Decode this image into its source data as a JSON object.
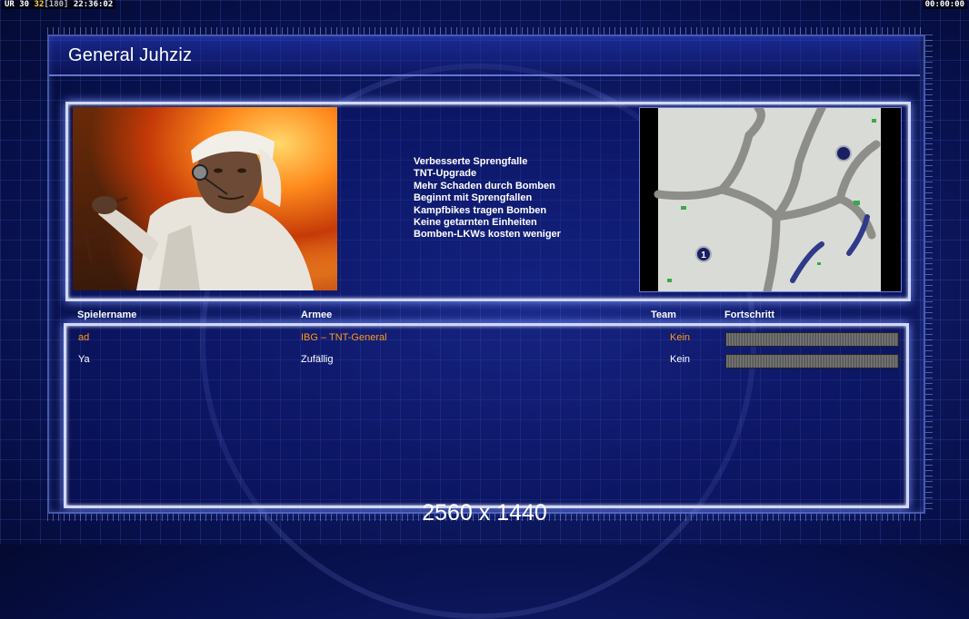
{
  "hud": {
    "left_prefix": "UR",
    "fps_a": "30",
    "fps_b": "32",
    "fps_c": "[180]",
    "clock": "22:36:02",
    "game_timer": "00:00:00"
  },
  "title": "General Juhziz",
  "general_bonuses": [
    "Verbesserte Sprengfalle",
    "TNT-Upgrade",
    "Mehr Schaden durch Bomben",
    "Beginnt mit Sprengfallen",
    "Kampfbikes tragen Bomben",
    "Keine getarnten Einheiten",
    "Bomben-LKWs kosten weniger"
  ],
  "minimap": {
    "start_marker": "1"
  },
  "columns": {
    "player_name": "Spielername",
    "army": "Armee",
    "team": "Team",
    "progress": "Fortschritt"
  },
  "players": [
    {
      "name": "ad",
      "army": "IBG – TNT-General",
      "team": "Kein",
      "color": "#ff9a1a",
      "progress": 1.0
    },
    {
      "name": "Ya",
      "army": "Zufällig",
      "team": "Kein",
      "color": "#ffffff",
      "progress": 1.0
    }
  ],
  "resolution_label": "2560 x 1440",
  "colors": {
    "accent": "#cfd8ff",
    "highlight_player": "#ff9a1a",
    "background": "#0f1a66"
  }
}
